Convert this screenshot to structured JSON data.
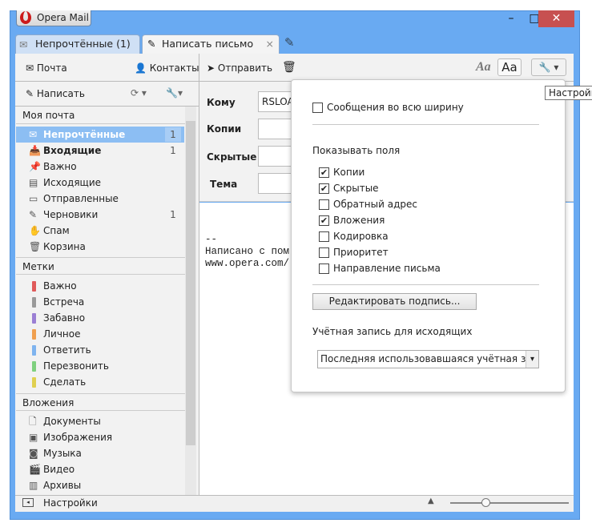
{
  "app": {
    "title": "Opera Mail"
  },
  "window_controls": {
    "minimize": "–",
    "maximize": "□",
    "close": "✕"
  },
  "tabs": [
    {
      "label": "Непрочтённые (1)",
      "active": false
    },
    {
      "label": "Написать письмо",
      "active": true
    }
  ],
  "tab_close": "×",
  "toolbar": {
    "mail": "Почта",
    "contacts": "Контакты",
    "compose": "Написать",
    "send": "Отправить",
    "font_italic": "Aa",
    "font_plain": "Aa",
    "settings_tooltip": "Настройки"
  },
  "sidebar": {
    "my_mail": {
      "header": "Моя почта",
      "items": [
        {
          "label": "Непрочтённые",
          "count": "1",
          "selected": true,
          "icon": "envelope-icon"
        },
        {
          "label": "Входящие",
          "count": "1",
          "bold": true,
          "icon": "inbox-icon"
        },
        {
          "label": "Важно",
          "icon": "pin-icon"
        },
        {
          "label": "Исходящие",
          "icon": "outbox-icon"
        },
        {
          "label": "Отправленные",
          "icon": "sent-icon"
        },
        {
          "label": "Черновики",
          "count": "1",
          "icon": "pencil-icon"
        },
        {
          "label": "Спам",
          "icon": "hand-icon"
        },
        {
          "label": "Корзина",
          "icon": "trash-icon"
        }
      ]
    },
    "labels": {
      "header": "Метки",
      "items": [
        {
          "label": "Важно",
          "color": "#e05a5a"
        },
        {
          "label": "Встреча",
          "color": "#9a9a9a"
        },
        {
          "label": "Забавно",
          "color": "#9b7fd4"
        },
        {
          "label": "Личное",
          "color": "#f0a050"
        },
        {
          "label": "Ответить",
          "color": "#7fb4ef"
        },
        {
          "label": "Перезвонить",
          "color": "#7fd07f"
        },
        {
          "label": "Сделать",
          "color": "#e0d050"
        }
      ]
    },
    "attachments": {
      "header": "Вложения",
      "items": [
        {
          "label": "Документы",
          "icon": "document-icon"
        },
        {
          "label": "Изображения",
          "icon": "image-icon"
        },
        {
          "label": "Музыка",
          "icon": "speaker-icon"
        },
        {
          "label": "Видео",
          "icon": "clapper-icon"
        },
        {
          "label": "Архивы",
          "icon": "archive-icon"
        }
      ]
    }
  },
  "compose": {
    "to_label": "Кому",
    "to_value": "RSLOA",
    "cc_label": "Копии",
    "bcc_label": "Скрытые",
    "subject_label": "Тема",
    "body": [
      "--",
      "Написано с пом",
      "www.opera.com/"
    ]
  },
  "popup": {
    "full_width": {
      "label": "Сообщения во всю ширину",
      "checked": false
    },
    "show_fields_header": "Показывать поля",
    "fields": [
      {
        "label": "Копии",
        "checked": true
      },
      {
        "label": "Скрытые",
        "checked": true
      },
      {
        "label": "Обратный адрес",
        "checked": false
      },
      {
        "label": "Вложения",
        "checked": true
      },
      {
        "label": "Кодировка",
        "checked": false
      },
      {
        "label": "Приоритет",
        "checked": false
      },
      {
        "label": "Направление письма",
        "checked": false
      }
    ],
    "edit_signature": "Редактировать подпись...",
    "account_header": "Учётная запись для исходящих",
    "account_select": "Последняя использовавшаяся учётная запись"
  },
  "statusbar": {
    "label": "Настройки",
    "zoom_level": 0.3
  }
}
